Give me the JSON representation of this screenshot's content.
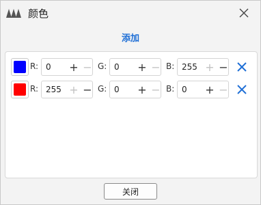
{
  "window": {
    "title": "颜色"
  },
  "toolbar": {
    "add_label": "添加"
  },
  "colors": [
    {
      "swatch": "#0000ff",
      "r_label": "R:",
      "r": "0",
      "g_label": "G:",
      "g": "0",
      "b_label": "B:",
      "b": "255"
    },
    {
      "swatch": "#ff0000",
      "r_label": "R:",
      "r": "255",
      "g_label": "G:",
      "g": "0",
      "b_label": "B:",
      "b": "0"
    }
  ],
  "spin": {
    "plus": "+",
    "minus": "−"
  },
  "footer": {
    "close_label": "关闭"
  },
  "accent": "#1f6fd6",
  "icons": {
    "app": "app-logo-icon",
    "close": "close-icon",
    "delete": "delete-icon"
  }
}
